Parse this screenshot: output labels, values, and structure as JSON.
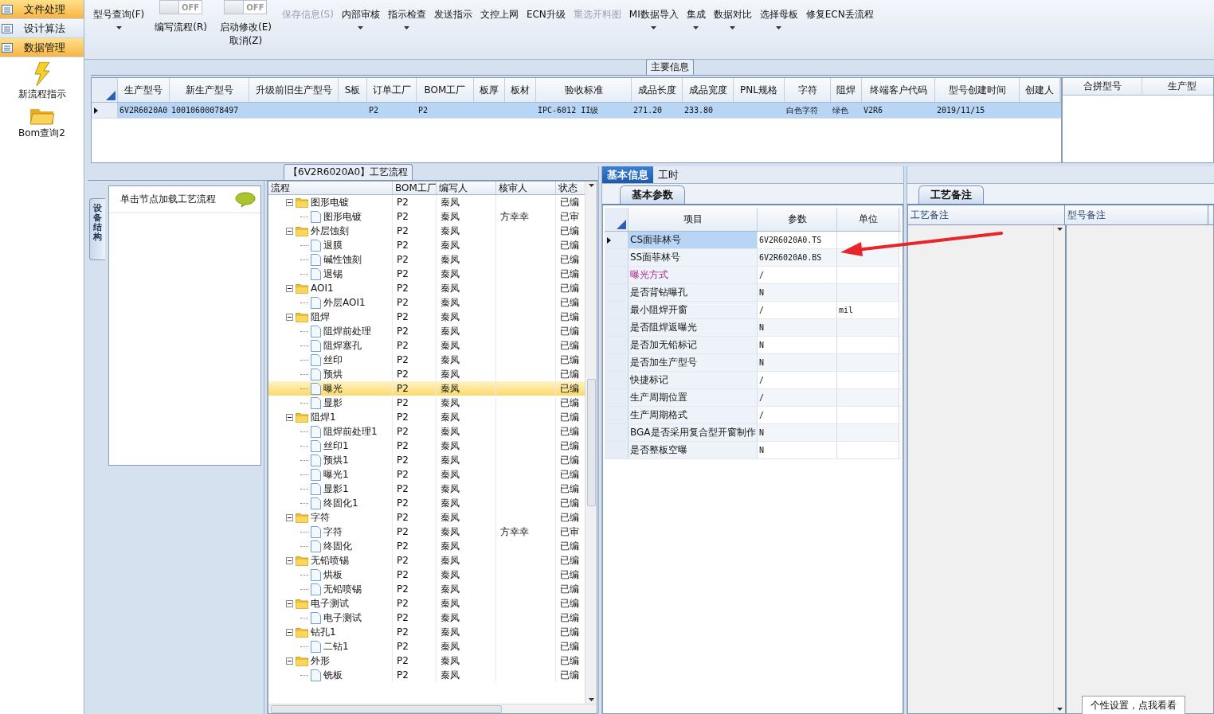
{
  "sidebar": {
    "menu": [
      {
        "label": "文件处理",
        "selected": true
      },
      {
        "label": "设计算法",
        "selected": false
      },
      {
        "label": "数据管理",
        "selected": true
      }
    ],
    "shortcuts": [
      {
        "label": "新流程指示",
        "kind": "lightning"
      },
      {
        "label": "Bom查询2",
        "kind": "folder"
      }
    ]
  },
  "toolbar": {
    "items": [
      {
        "kind": "button",
        "label": "型号查询(F)",
        "dropdown": true,
        "disabled": false
      },
      {
        "kind": "toggle",
        "switch_text": "OFF",
        "on": false,
        "label": "编写流程(R)"
      },
      {
        "kind": "toggle",
        "switch_text": "OFF",
        "on": false,
        "label": "启动修改(E)",
        "second_label": "取消(Z)"
      },
      {
        "kind": "button",
        "label": "保存信息(S)",
        "dropdown": false,
        "disabled": true
      },
      {
        "kind": "button",
        "label": "内部审核",
        "dropdown": true,
        "disabled": false
      },
      {
        "kind": "button",
        "label": "指示检查",
        "dropdown": true,
        "disabled": false
      },
      {
        "kind": "button",
        "label": "发送指示",
        "dropdown": false,
        "disabled": false
      },
      {
        "kind": "button",
        "label": "文控上网",
        "dropdown": false,
        "disabled": false
      },
      {
        "kind": "button",
        "label": "ECN升级",
        "dropdown": false,
        "disabled": false
      },
      {
        "kind": "button",
        "label": "重选开料图",
        "dropdown": false,
        "disabled": true
      },
      {
        "kind": "button",
        "label": "MI数据导入",
        "dropdown": true,
        "disabled": false
      },
      {
        "kind": "button",
        "label": "集成",
        "dropdown": true,
        "disabled": false
      },
      {
        "kind": "button",
        "label": "数据对比",
        "dropdown": true,
        "disabled": false
      },
      {
        "kind": "button",
        "label": "选择母板",
        "dropdown": true,
        "disabled": false
      },
      {
        "kind": "button",
        "label": "修复ECN丢流程",
        "dropdown": false,
        "disabled": false
      }
    ]
  },
  "main_info": {
    "title": "主要信息",
    "columns": [
      "生产型号",
      "新生产型号",
      "升级前旧生产型号",
      "S板",
      "订单工厂",
      "BOM工厂",
      "板厚",
      "板材",
      "验收标准",
      "成品长度",
      "成品宽度",
      "PNL规格",
      "字符",
      "阻焊",
      "终端客户代码",
      "型号创建时间",
      "创建人"
    ],
    "rows": [
      {
        "selected": true,
        "cells": [
          "6V2R6020A0",
          "10010600078497",
          null,
          null,
          "P2",
          "P2",
          null,
          null,
          "IPC-6012 II级",
          "271.20",
          "233.80",
          null,
          "白色字符",
          "绿色",
          "V2R6",
          "2019/11/15",
          null
        ]
      }
    ],
    "side_table": {
      "columns": [
        "合拼型号",
        "生产型"
      ]
    }
  },
  "flow_panel": {
    "title": "【6V2R6020A0】工艺流程",
    "side_tab": "设备结构",
    "hint": "单击节点加载工艺流程",
    "tree": {
      "columns": [
        "流程",
        "BOM工厂",
        "编写人",
        "核审人",
        "状态"
      ],
      "nodes": [
        {
          "kind": "folder",
          "name": "图形电镀",
          "bom": "P2",
          "writer": "秦凤",
          "status": "已编",
          "expanded": true,
          "selected": false,
          "children": [
            {
              "kind": "file",
              "name": "图形电镀",
              "bom": "P2",
              "writer": "秦凤",
              "reviewer": "方幸幸",
              "status": "已审",
              "selected": false
            }
          ]
        },
        {
          "kind": "folder",
          "name": "外层蚀刻",
          "bom": "P2",
          "writer": "秦凤",
          "status": "已编",
          "expanded": true,
          "selected": false,
          "children": [
            {
              "kind": "file",
              "name": "退膜",
              "bom": "P2",
              "writer": "秦凤",
              "status": "已编",
              "selected": false
            },
            {
              "kind": "file",
              "name": "碱性蚀刻",
              "bom": "P2",
              "writer": "秦凤",
              "status": "已编",
              "selected": false
            },
            {
              "kind": "file",
              "name": "退锡",
              "bom": "P2",
              "writer": "秦凤",
              "status": "已编",
              "selected": false
            }
          ]
        },
        {
          "kind": "folder",
          "name": "AOI1",
          "bom": "P2",
          "writer": "秦凤",
          "status": "已编",
          "expanded": true,
          "selected": false,
          "children": [
            {
              "kind": "file",
              "name": "外层AOI1",
              "bom": "P2",
              "writer": "秦凤",
              "status": "已编",
              "selected": false
            }
          ]
        },
        {
          "kind": "folder",
          "name": "阻焊",
          "bom": "P2",
          "writer": "秦凤",
          "status": "已编",
          "expanded": true,
          "selected": false,
          "children": [
            {
              "kind": "file",
              "name": "阻焊前处理",
              "bom": "P2",
              "writer": "秦凤",
              "status": "已编",
              "selected": false
            },
            {
              "kind": "file",
              "name": "阻焊塞孔",
              "bom": "P2",
              "writer": "秦凤",
              "status": "已编",
              "selected": false
            },
            {
              "kind": "file",
              "name": "丝印",
              "bom": "P2",
              "writer": "秦凤",
              "status": "已编",
              "selected": false
            },
            {
              "kind": "file",
              "name": "预烘",
              "bom": "P2",
              "writer": "秦凤",
              "status": "已编",
              "selected": false
            },
            {
              "kind": "file",
              "name": "曝光",
              "bom": "P2",
              "writer": "秦凤",
              "status": "已编",
              "selected": true
            },
            {
              "kind": "file",
              "name": "显影",
              "bom": "P2",
              "writer": "秦凤",
              "status": "已编",
              "selected": false
            }
          ]
        },
        {
          "kind": "folder",
          "name": "阻焊1",
          "bom": "P2",
          "writer": "秦凤",
          "status": "已编",
          "expanded": true,
          "selected": false,
          "children": [
            {
              "kind": "file",
              "name": "阻焊前处理1",
              "bom": "P2",
              "writer": "秦凤",
              "status": "已编",
              "selected": false
            },
            {
              "kind": "file",
              "name": "丝印1",
              "bom": "P2",
              "writer": "秦凤",
              "status": "已编",
              "selected": false
            },
            {
              "kind": "file",
              "name": "预烘1",
              "bom": "P2",
              "writer": "秦凤",
              "status": "已编",
              "selected": false
            },
            {
              "kind": "file",
              "name": "曝光1",
              "bom": "P2",
              "writer": "秦凤",
              "status": "已编",
              "selected": false
            },
            {
              "kind": "file",
              "name": "显影1",
              "bom": "P2",
              "writer": "秦凤",
              "status": "已编",
              "selected": false
            },
            {
              "kind": "file",
              "name": "终固化1",
              "bom": "P2",
              "writer": "秦凤",
              "status": "已编",
              "selected": false
            }
          ]
        },
        {
          "kind": "folder",
          "name": "字符",
          "bom": "P2",
          "writer": "秦凤",
          "status": "已编",
          "expanded": true,
          "selected": false,
          "children": [
            {
              "kind": "file",
              "name": "字符",
              "bom": "P2",
              "writer": "秦凤",
              "reviewer": "方幸幸",
              "status": "已审",
              "selected": false
            },
            {
              "kind": "file",
              "name": "终固化",
              "bom": "P2",
              "writer": "秦凤",
              "status": "已编",
              "selected": false
            }
          ]
        },
        {
          "kind": "folder",
          "name": "无铅喷锡",
          "bom": "P2",
          "writer": "秦凤",
          "status": "已编",
          "expanded": true,
          "selected": false,
          "children": [
            {
              "kind": "file",
              "name": "烘板",
              "bom": "P2",
              "writer": "秦凤",
              "status": "已编",
              "selected": false
            },
            {
              "kind": "file",
              "name": "无铅喷锡",
              "bom": "P2",
              "writer": "秦凤",
              "status": "已编",
              "selected": false
            }
          ]
        },
        {
          "kind": "folder",
          "name": "电子测试",
          "bom": "P2",
          "writer": "秦凤",
          "status": "已编",
          "expanded": true,
          "selected": false,
          "children": [
            {
              "kind": "file",
              "name": "电子测试",
              "bom": "P2",
              "writer": "秦凤",
              "status": "已编",
              "selected": false
            }
          ]
        },
        {
          "kind": "folder",
          "name": "钻孔1",
          "bom": "P2",
          "writer": "秦凤",
          "status": "已编",
          "expanded": true,
          "selected": false,
          "children": [
            {
              "kind": "file",
              "name": "二钻1",
              "bom": "P2",
              "writer": "秦凤",
              "status": "已编",
              "selected": false
            }
          ]
        },
        {
          "kind": "folder",
          "name": "外形",
          "bom": "P2",
          "writer": "秦凤",
          "status": "已编",
          "expanded": true,
          "selected": false,
          "children": [
            {
              "kind": "file",
              "name": "铣板",
              "bom": "P2",
              "writer": "秦凤",
              "status": "已编",
              "selected": false
            }
          ]
        }
      ]
    }
  },
  "detail": {
    "tabs": [
      {
        "label": "基本信息",
        "selected": true
      },
      {
        "label": "工时",
        "selected": false
      }
    ],
    "subtab": "基本参数",
    "columns": [
      "项目",
      "参数",
      "单位"
    ],
    "rows": [
      {
        "item": "CS面菲林号",
        "value": "6V2R6020A0.TS",
        "selected": true,
        "flagged": false
      },
      {
        "item": "SS面菲林号",
        "value": "6V2R6020A0.BS",
        "selected": false,
        "flagged": false
      },
      {
        "item": "曝光方式",
        "value": "/",
        "selected": false,
        "flagged": true
      },
      {
        "item": "是否背钻曝孔",
        "value": "N",
        "selected": false,
        "flagged": false
      },
      {
        "item": "最小阻焊开窗",
        "value": "/",
        "unit": "mil",
        "selected": false,
        "flagged": false
      },
      {
        "item": "是否阻焊返曝光",
        "value": "N",
        "selected": false,
        "flagged": false
      },
      {
        "item": "是否加无铅标记",
        "value": "N",
        "selected": false,
        "flagged": false
      },
      {
        "item": "是否加生产型号",
        "value": "N",
        "selected": false,
        "flagged": false
      },
      {
        "item": "快捷标记",
        "value": "/",
        "selected": false,
        "flagged": false
      },
      {
        "item": "生产周期位置",
        "value": "/",
        "selected": false,
        "flagged": false
      },
      {
        "item": "生产周期格式",
        "value": "/",
        "selected": false,
        "flagged": false
      },
      {
        "item": "BGA是否采用复合型开窗制作",
        "value": "N",
        "selected": false,
        "flagged": false
      },
      {
        "item": "是否整板空曝",
        "value": "N",
        "selected": false,
        "flagged": false
      }
    ]
  },
  "notes": {
    "tab": "工艺备注",
    "columns": [
      "工艺备注",
      "型号备注"
    ],
    "tip_button": "个性设置，点我看看"
  }
}
